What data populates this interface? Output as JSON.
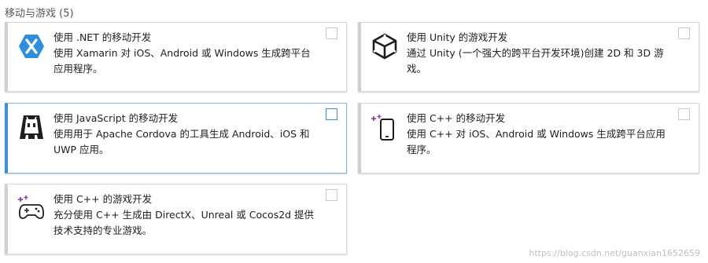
{
  "section": {
    "title": "移动与游戏 (5)"
  },
  "cards": [
    {
      "icon": "xamarin-icon",
      "title": "使用 .NET 的移动开发",
      "desc": "使用 Xamarin 对 iOS、Android 或 Windows 生成跨平台应用程序。",
      "checked": false,
      "selected": false
    },
    {
      "icon": "unity-icon",
      "title": "使用 Unity 的游戏开发",
      "desc": "通过 Unity (一个强大的跨平台开发环境)创建 2D 和 3D 游戏。",
      "checked": false,
      "selected": false
    },
    {
      "icon": "cordova-icon",
      "title": "使用 JavaScript 的移动开发",
      "desc": "使用用于 Apache Cordova 的工具生成 Android、iOS 和 UWP 应用。",
      "checked": false,
      "selected": true
    },
    {
      "icon": "mobile-device-icon",
      "title": "使用 C++ 的移动开发",
      "desc": "使用 C++ 对 iOS、Android 或 Windows 生成跨平台应用程序。",
      "checked": false,
      "selected": false
    },
    {
      "icon": "gamepad-icon",
      "title": "使用 C++ 的游戏开发",
      "desc": "充分使用 C++ 生成由 DirectX、Unreal 或 Cocos2d 提供技术支持的专业游戏。",
      "checked": false,
      "selected": false
    }
  ],
  "watermark": "https://blog.csdn.net/guanxian1652659",
  "colors": {
    "accent": "#3c8fd8",
    "xamarin": "#2f8fdc",
    "dark": "#1e1e1e"
  }
}
